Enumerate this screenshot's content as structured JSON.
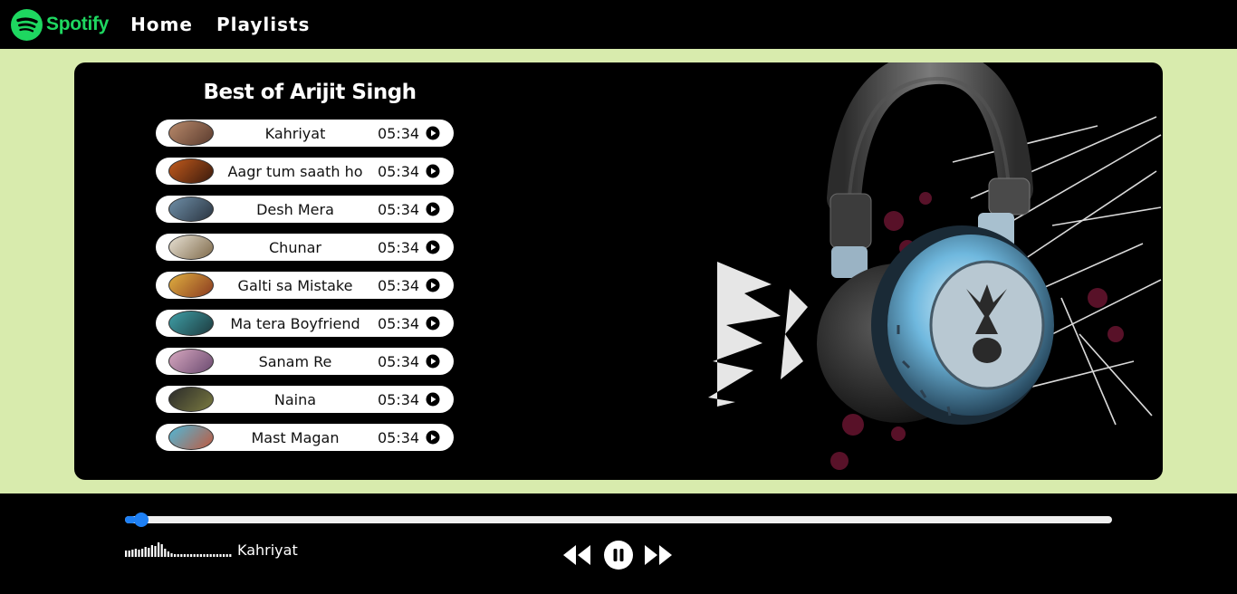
{
  "navbar": {
    "brand": "Spotify",
    "links": [
      "Home",
      "Playlists"
    ]
  },
  "playlist": {
    "title": "Best of Arijit Singh",
    "songs": [
      {
        "name": "Kahriyat",
        "duration": "05:34",
        "thumb_colors": [
          "#b98a6b",
          "#5a3b2e"
        ]
      },
      {
        "name": "Aagr tum saath ho",
        "duration": "05:34",
        "thumb_colors": [
          "#c25a1c",
          "#3a1a0d"
        ]
      },
      {
        "name": "Desh Mera",
        "duration": "05:34",
        "thumb_colors": [
          "#6f8fa8",
          "#2a3440"
        ]
      },
      {
        "name": "Chunar",
        "duration": "05:34",
        "thumb_colors": [
          "#e8e2d5",
          "#7f6a4a"
        ]
      },
      {
        "name": "Galti sa Mistake",
        "duration": "05:34",
        "thumb_colors": [
          "#e0b040",
          "#8a3a20"
        ]
      },
      {
        "name": "Ma tera Boyfriend",
        "duration": "05:34",
        "thumb_colors": [
          "#3fa0a8",
          "#1d3a3e"
        ]
      },
      {
        "name": "Sanam Re",
        "duration": "05:34",
        "thumb_colors": [
          "#d8a8c0",
          "#6a4a70"
        ]
      },
      {
        "name": "Naina",
        "duration": "05:34",
        "thumb_colors": [
          "#2a2a2a",
          "#7a7a40"
        ]
      },
      {
        "name": "Mast Magan",
        "duration": "05:34",
        "thumb_colors": [
          "#4fb8d8",
          "#c05a40"
        ]
      }
    ]
  },
  "player": {
    "current_song": "Kahriyat",
    "progress": 0.011,
    "state": "playing",
    "controls": [
      "previous-icon",
      "pause-icon",
      "next-icon"
    ]
  },
  "colors": {
    "accent": "#1ed760",
    "page_bg": "#d8ebad",
    "progress": "#1e80f5"
  }
}
